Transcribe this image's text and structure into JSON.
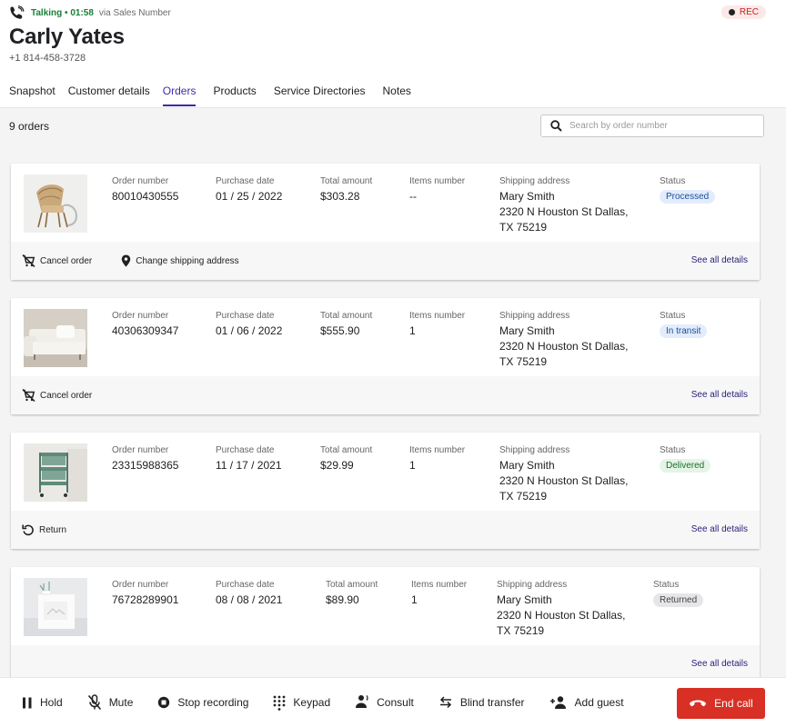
{
  "call": {
    "status": "Talking",
    "timer": "01:58",
    "status_full": "Talking • 01:58",
    "via": "via Sales Number",
    "rec_label": "REC"
  },
  "customer": {
    "name": "Carly Yates",
    "phone": "+1 814-458-3728"
  },
  "tabs": [
    {
      "label": "Snapshot",
      "active": false
    },
    {
      "label": "Customer details",
      "active": false
    },
    {
      "label": "Orders",
      "active": true
    },
    {
      "label": "Products",
      "active": false
    },
    {
      "label": "Service Directories",
      "active": false
    },
    {
      "label": "Notes",
      "active": false
    }
  ],
  "orders_toolbar": {
    "count": "9 orders",
    "search_placeholder": "Search by order number"
  },
  "labels": {
    "order_number": "Order number",
    "purchase_date": "Purchase date",
    "total_amount": "Total amount",
    "items_number": "Items number",
    "shipping_address": "Shipping address",
    "status": "Status",
    "see_all": "See all details"
  },
  "orders": [
    {
      "image": "rattan-chair",
      "order_number": "80010430555",
      "purchase_date": "01 / 25 / 2022",
      "total_amount": "$303.28",
      "items_number": "--",
      "ship_name": "Mary Smith",
      "ship_line1": "2320 N Houston St Dallas,",
      "ship_line2": "TX 75219",
      "status": "Processed",
      "status_color": "#e3ecfb",
      "status_text_color": "#1a4fa0",
      "actions": [
        {
          "label": "Cancel order",
          "icon": "cart-off-icon"
        },
        {
          "label": "Change shipping address",
          "icon": "location-pin-icon"
        }
      ]
    },
    {
      "image": "sofa",
      "order_number": "40306309347",
      "purchase_date": "01 / 06 / 2022",
      "total_amount": "$555.90",
      "items_number": "1",
      "ship_name": "Mary Smith",
      "ship_line1": "2320 N Houston St Dallas,",
      "ship_line2": "TX 75219",
      "status": "In transit",
      "status_color": "#e3ecfb",
      "status_text_color": "#1a4fa0",
      "actions": [
        {
          "label": "Cancel order",
          "icon": "cart-off-icon"
        }
      ]
    },
    {
      "image": "utility-cart",
      "order_number": "23315988365",
      "purchase_date": "11 / 17 / 2021",
      "total_amount": "$29.99",
      "items_number": "1",
      "ship_name": "Mary Smith",
      "ship_line1": "2320 N Houston St Dallas,",
      "ship_line2": "TX 75219",
      "status": "Delivered",
      "status_color": "#e4f4e6",
      "status_text_color": "#1d6b2c",
      "actions": [
        {
          "label": "Return",
          "icon": "return-icon"
        }
      ]
    },
    {
      "image": "white-cabinet",
      "order_number": "76728289901",
      "purchase_date": "08 / 08 / 2021",
      "total_amount": "$89.90",
      "items_number": "1",
      "ship_name": "Mary Smith",
      "ship_line1": "2320 N Houston St Dallas,",
      "ship_line2": "TX 75219",
      "status": "Returned",
      "status_color": "#e6e6e8",
      "status_text_color": "#444444",
      "actions": []
    }
  ],
  "callbar": {
    "hold": "Hold",
    "mute": "Mute",
    "stop_recording": "Stop recording",
    "keypad": "Keypad",
    "consult": "Consult",
    "blind_transfer": "Blind transfer",
    "add_guest": "Add guest",
    "end_call": "End call"
  },
  "colors": {
    "accent": "#3f2aa8",
    "talking": "#188038",
    "end_call": "#d93025",
    "link": "#2a237a"
  }
}
